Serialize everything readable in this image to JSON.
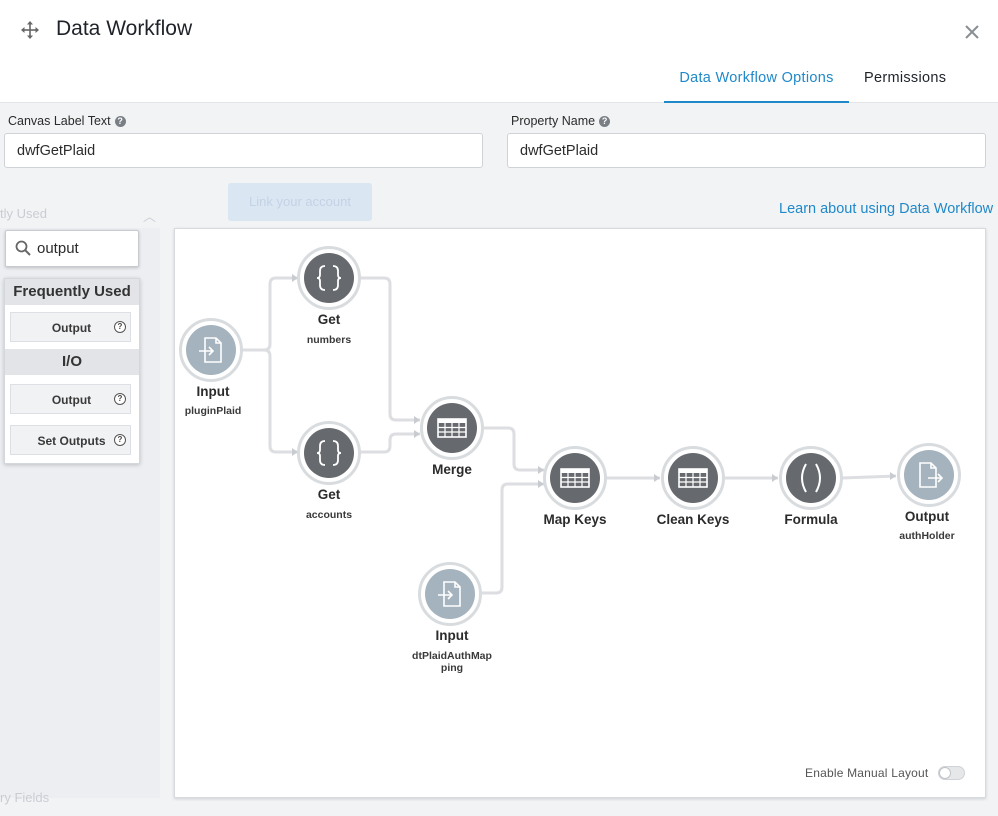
{
  "background": {
    "recent_label": "tly Used",
    "link_button": "Link your account",
    "fields_label": "ry Fields"
  },
  "header": {
    "title": "Data Workflow",
    "tabs": [
      {
        "label": "Data Workflow Options",
        "active": true
      },
      {
        "label": "Permissions",
        "active": false
      }
    ]
  },
  "fields": {
    "canvas_label": {
      "label": "Canvas Label Text",
      "value": "dwfGetPlaid"
    },
    "property_name": {
      "label": "Property Name",
      "value": "dwfGetPlaid"
    }
  },
  "learn_link": "Learn about using Data Workflow",
  "search": {
    "value": "output"
  },
  "palette": {
    "sections": [
      {
        "title": "Frequently Used",
        "items": [
          "Output"
        ]
      },
      {
        "title": "I/O",
        "items": [
          "Output",
          "Set Outputs"
        ]
      }
    ]
  },
  "nodes": [
    {
      "id": "input1",
      "label": "Input",
      "sub": "pluginPlaid",
      "icon": "file-input-icon"
    },
    {
      "id": "get1",
      "label": "Get",
      "sub": "numbers",
      "icon": "braces-icon"
    },
    {
      "id": "get2",
      "label": "Get",
      "sub": "accounts",
      "icon": "braces-icon"
    },
    {
      "id": "merge",
      "label": "Merge",
      "sub": "",
      "icon": "table-icon"
    },
    {
      "id": "input2",
      "label": "Input",
      "sub": "dtPlaidAuthMap ping",
      "icon": "file-input-icon"
    },
    {
      "id": "mapkeys",
      "label": "Map Keys",
      "sub": "",
      "icon": "table-icon"
    },
    {
      "id": "cleankeys",
      "label": "Clean Keys",
      "sub": "",
      "icon": "table-icon"
    },
    {
      "id": "formula",
      "label": "Formula",
      "sub": "",
      "icon": "parentheses-icon"
    },
    {
      "id": "output",
      "label": "Output",
      "sub": "authHolder",
      "icon": "file-output-icon"
    }
  ],
  "manual_layout": {
    "label": "Enable Manual Layout",
    "enabled": false
  },
  "colors": {
    "accent": "#1f89c9",
    "node_dark": "#666a6e",
    "node_light": "#a4b3bd"
  }
}
